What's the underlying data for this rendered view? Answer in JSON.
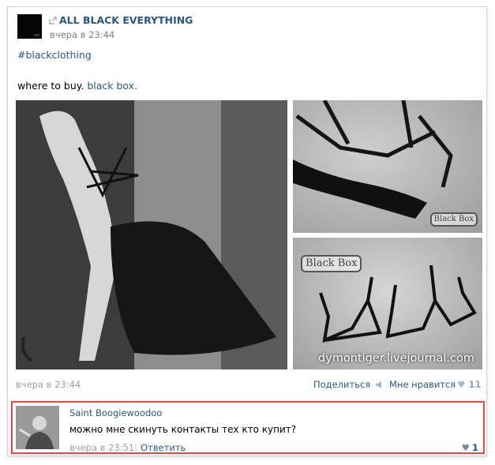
{
  "post": {
    "author": "ALL BLACK EVERYTHING",
    "time": "вчера в 23:44",
    "hashtag": "#blackclothing",
    "text_prefix": "where to buy. ",
    "text_link": "black box.",
    "photos": {
      "main_alt": "woman in black strap harness top and leather skirt",
      "top_right_alt": "black leather strap harness on gray background",
      "bottom_right_alt": "two black strap harness bras on gray background",
      "watermark_top": "Black Box",
      "watermark_bottom": "Black Box",
      "source": "dymontiger.livejournal.com"
    },
    "footer": {
      "time": "вчера в 23:44",
      "share_label": "Поделиться",
      "like_label": "Мне нравится",
      "like_count": "11"
    }
  },
  "comment": {
    "author": "Saint Boogiewoodoo",
    "text": "можно мне скинуть контакты тех кто купит?",
    "time": "вчера в 23:51",
    "separator": "|",
    "reply_label": "Ответить",
    "like_count": "1"
  },
  "colors": {
    "link": "#2b587a",
    "meta": "#a0a0a0",
    "highlight_border": "#e34848"
  },
  "icons": {
    "repost": "repost-arrow-icon",
    "share": "megaphone-icon",
    "heart": "heart-icon"
  }
}
